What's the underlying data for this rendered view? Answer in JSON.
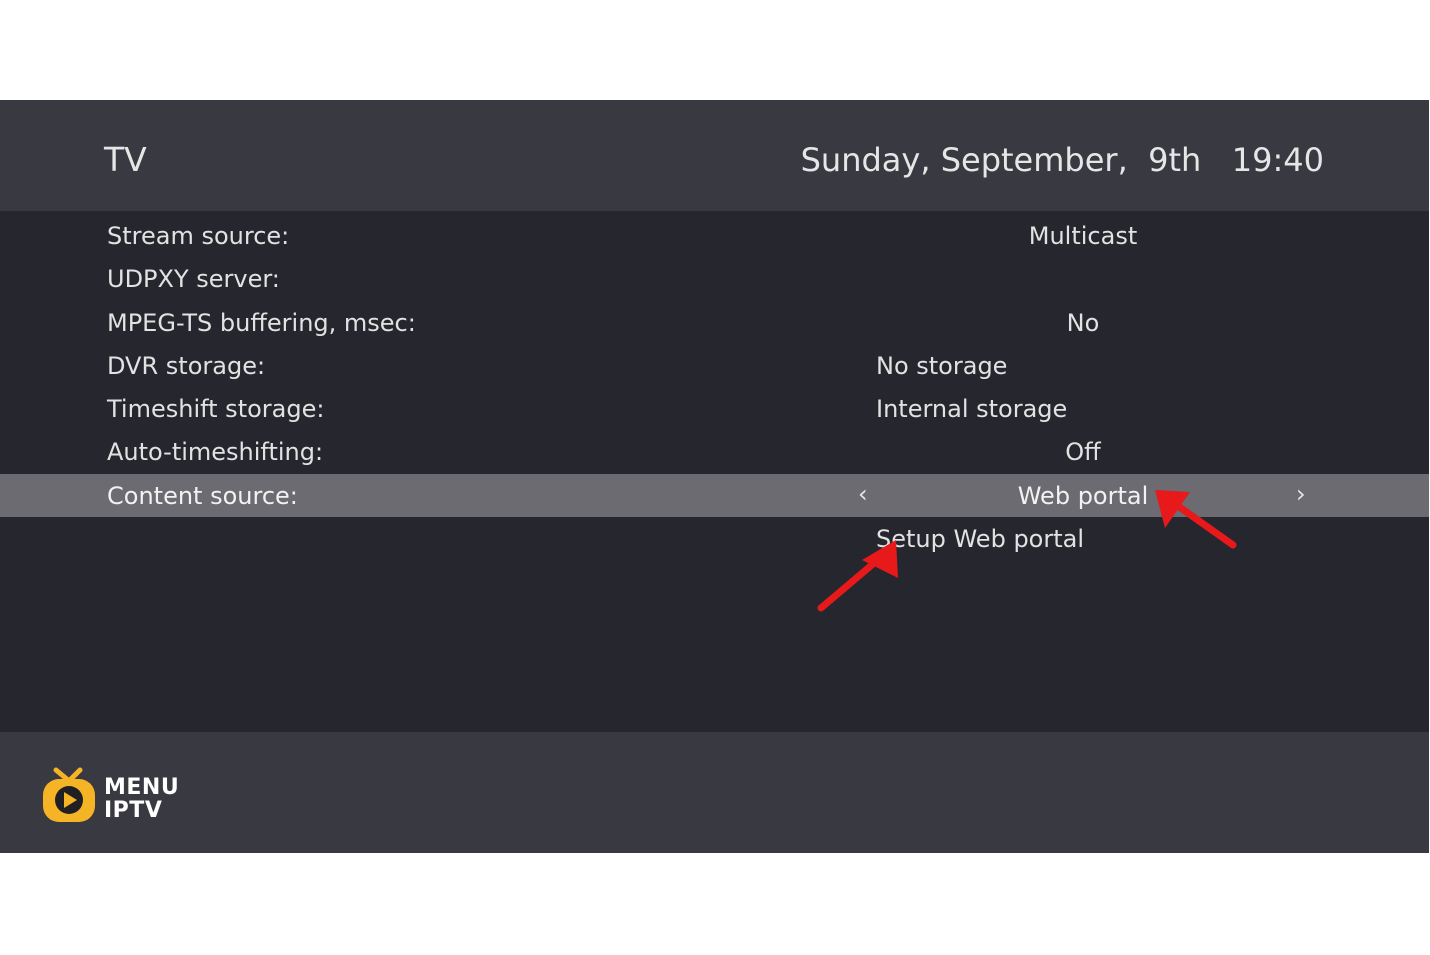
{
  "header": {
    "title": "TV",
    "datetime": "Sunday, September,  9th   19:40"
  },
  "settings": [
    {
      "label": "Stream source:",
      "value": "Multicast"
    },
    {
      "label": "UDPXY server:",
      "value": ""
    },
    {
      "label": "MPEG-TS buffering, msec:",
      "value": "No"
    },
    {
      "label": "DVR storage:",
      "value": "No storage"
    },
    {
      "label": "Timeshift storage:",
      "value": "Internal storage"
    },
    {
      "label": "Auto-timeshifting:",
      "value": "Off"
    },
    {
      "label": "Content source:",
      "value": "Web portal",
      "selected": true,
      "prev_icon": "‹",
      "next_icon": "›"
    },
    {
      "label": "",
      "value": "Setup Web portal"
    }
  ],
  "logo": {
    "line1": "MENU",
    "line2": "IPTV",
    "icon": "tv-play-icon",
    "color": "#f5b426"
  },
  "annotations": {
    "arrow_color": "#e8191b"
  },
  "colors": {
    "background": "#26262e",
    "header": "#393941",
    "selected_row": "#6b6b71",
    "text": "#e2e2e2"
  }
}
